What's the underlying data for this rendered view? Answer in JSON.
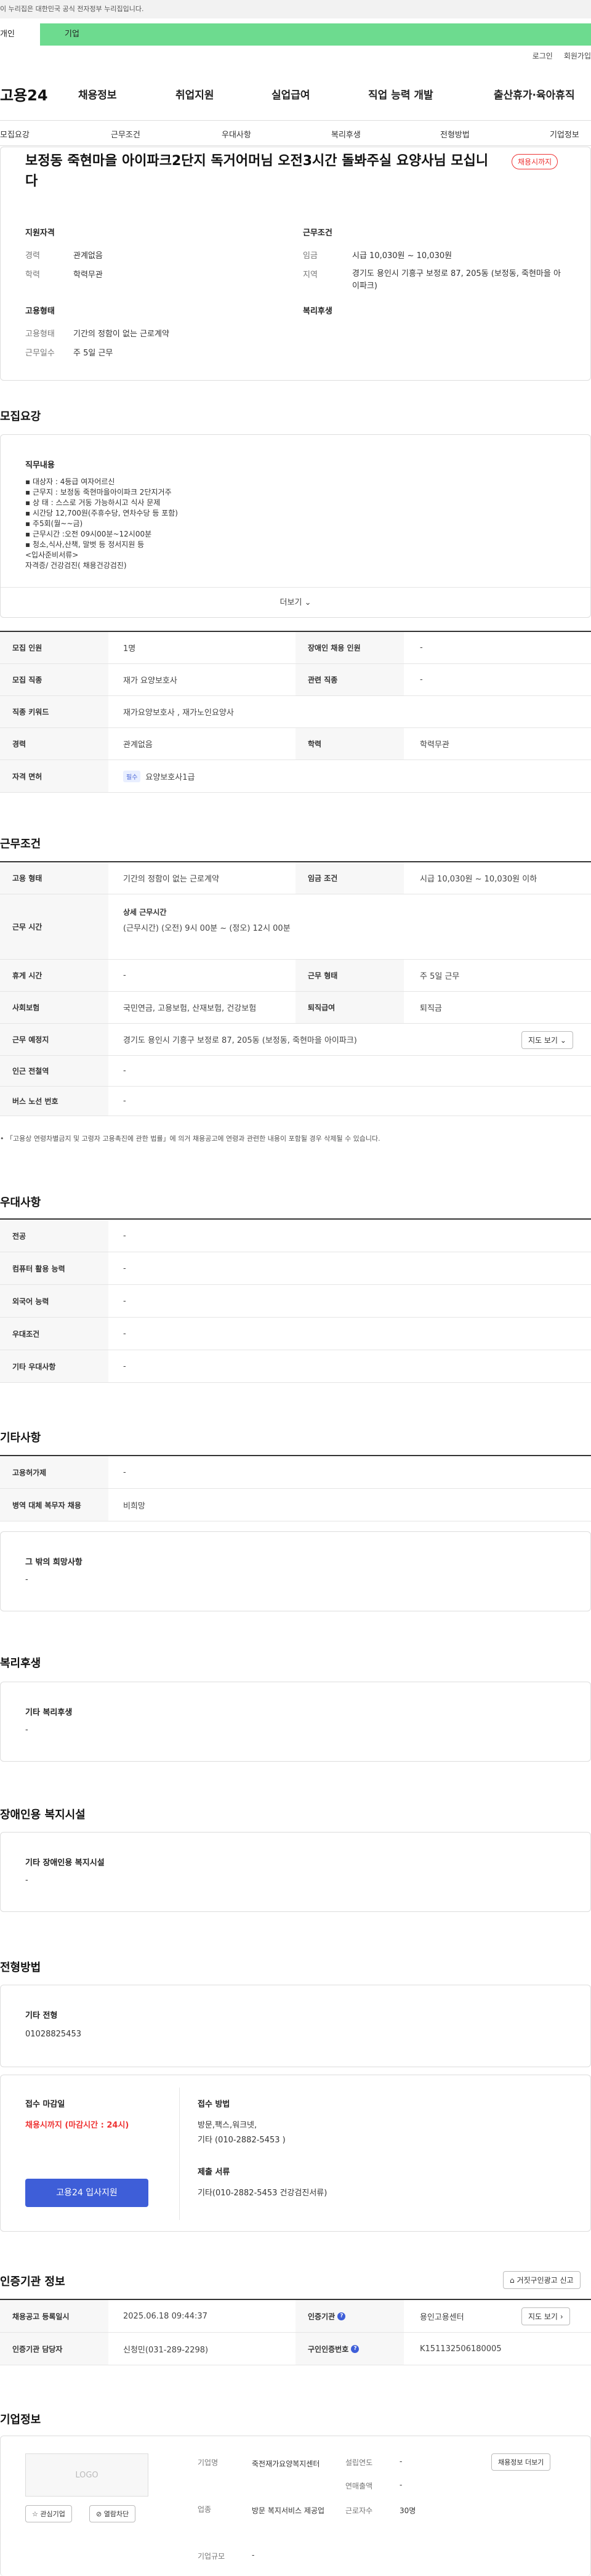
{
  "gov_banner": "이 누리집은 대한민국 공식 전자정부 누리집입니다.",
  "tabs": {
    "personal": "개인",
    "business": "기업"
  },
  "util": {
    "login": "로그인",
    "join": "회원가입"
  },
  "logo": "고용24",
  "gnb": [
    "채용정보",
    "취업지원",
    "실업급여",
    "직업 능력 개발",
    "출산휴가·육아휴직"
  ],
  "subnav": [
    "모집요강",
    "근무조건",
    "우대사항",
    "복리후생",
    "전형방법",
    "기업정보"
  ],
  "job": {
    "title": "보정동 죽현마을 아이파크2단지 독거어머님 오전3시간 돌봐주실 요양사님 모십니다",
    "badge": "채용시까지",
    "qual_title": "지원자격",
    "career_k": "경력",
    "career_v": "관계없음",
    "edu_k": "학력",
    "edu_v": "학력무관",
    "cond_title": "근무조건",
    "wage_k": "임금",
    "wage_v": "시급 10,030원 ~ 10,030원",
    "region_k": "지역",
    "region_v": "경기도 용인시 기흥구 보정로 87, 205동 (보정동, 죽현마을 아이파크)",
    "type_title": "고용형태",
    "emp_k": "고용형태",
    "emp_v": "기간의 정함이 없는 근로계약",
    "days_k": "근무일수",
    "days_v": "주 5일 근무",
    "welfare_title": "복리후생"
  },
  "recruit": {
    "section": "모집요강",
    "duty_title": "직무내용",
    "duty_lines": [
      "▪ 대상자 : 4등급 여자어르신",
      "▪ 근무지 : 보정동 죽현마을아이파크 2단지거주",
      "▪ 상 태 : 스스로 거동 가능하시고 식사 문제",
      "▪ 시간당 12,700원(주휴수당, 연차수당 등 포함)",
      "▪ 주5회(월~~금)",
      "▪ 근무시간 :오전 09시00분~12시00분",
      "▪ 청소,식사,산책, 말벗 등 정서지원 등",
      "<입사준비서류>",
      "자격증/ 건강검진( 채용건강검진)"
    ],
    "more": "더보기",
    "rows": [
      {
        "k1": "모집 인원",
        "v1": "1명",
        "k2": "장애인 채용 인원",
        "v2": "-"
      },
      {
        "k1": "모집 직종",
        "v1": "재가 요양보호사",
        "k2": "관련 직종",
        "v2": "-"
      },
      {
        "k1": "직종 키워드",
        "v1": "재가요양보호사 , 재가노인요양사"
      },
      {
        "k1": "경력",
        "v1": "관계없음",
        "k2": "학력",
        "v2": "학력무관"
      },
      {
        "k1": "자격 면허",
        "tag": "필수",
        "v1": "요양보호사1급"
      }
    ]
  },
  "work": {
    "section": "근무조건",
    "emp_k": "고용 형태",
    "emp_v": "기간의 정함이 없는 근로계약",
    "wage_k": "임금 조건",
    "wage_v": "시급 10,030원 ~ 10,030원 이하",
    "time_k": "근무 시간",
    "time_title": "상세 근무시간",
    "time_v": "(근무시간) (오전) 9시 00분 ~ (정오) 12시 00분",
    "rest_k": "휴게 시간",
    "rest_v": "-",
    "form_k": "근무 형태",
    "form_v": "주 5일 근무",
    "ins_k": "사회보험",
    "ins_v": "국민연금, 고용보험, 산재보험, 건강보험",
    "ret_k": "퇴직급여",
    "ret_v": "퇴직금",
    "place_k": "근무 예정지",
    "place_v": "경기도 용인시 기흥구 보정로 87, 205동 (보정동, 죽현마을 아이파크)",
    "map_btn": "지도 보기",
    "subway_k": "인근 전철역",
    "subway_v": "-",
    "bus_k": "버스 노선 번호",
    "bus_v": "-",
    "note": "• 「고용상 연령차별금지 및 고령자 고용촉진에 관한 법률」에 의거 채용공고에 연령과 관련한 내용이 포함될 경우 삭제될 수 있습니다."
  },
  "pref": {
    "section": "우대사항",
    "rows": [
      {
        "k": "전공",
        "v": "-"
      },
      {
        "k": "컴퓨터 활용 능력",
        "v": "-"
      },
      {
        "k": "외국어 능력",
        "v": "-"
      },
      {
        "k": "우대조건",
        "v": "-"
      },
      {
        "k": "기타 우대사항",
        "v": "-"
      }
    ]
  },
  "etc": {
    "section": "기타사항",
    "rows": [
      {
        "k": "고용허가제",
        "v": "-"
      },
      {
        "k": "병역 대체 복무자 채용",
        "v": "비희망"
      }
    ],
    "box_title": "그 밖의 희망사항",
    "box_v": "-"
  },
  "benefit": {
    "section": "복리후생",
    "box_title": "기타 복리후생",
    "box_v": "-"
  },
  "disabled": {
    "section": "장애인용 복지시설",
    "box_title": "기타 장애인용 복지시설",
    "box_v": "-"
  },
  "process": {
    "section": "전형방법",
    "box_title": "기타 전형",
    "box_v": "01028825453",
    "deadline_title": "접수 마감일",
    "deadline_v": "채용시까지 (마감시간 : 24시)",
    "apply_btn": "고용24 입사지원",
    "method_title": "접수 방법",
    "method_v1": "방문,팩스,워크넷,",
    "method_v2": "기타 (010-2882-5453 )",
    "docs_title": "제출 서류",
    "docs_v": "기타(010-2882-5453 건강검진서류)"
  },
  "cert": {
    "section": "인증기관 정보",
    "report_btn": "거짓구인광고 신고",
    "reg_k": "채용공고 등록일시",
    "reg_v": "2025.06.18 09:44:37",
    "org_k": "인증기관",
    "org_v": "용인고용센터",
    "map_btn": "지도 보기",
    "mgr_k": "인증기관 담당자",
    "mgr_v": "신청민(031-289-2298)",
    "num_k": "구인인증번호",
    "num_v": "K151132506180005"
  },
  "company": {
    "section": "기업정보",
    "logo": "LOGO",
    "fav_btn": "관심기업",
    "block_btn": "열람차단",
    "jobs_btn": "채용정보 더보기",
    "name_k": "기업명",
    "name_v": "죽전재가요양복지센터",
    "ind_k": "업종",
    "ind_v": "방문 복지서비스 제공업",
    "size_k": "기업규모",
    "size_v": "-",
    "year_k": "설립연도",
    "year_v": "-",
    "sales_k": "연매출액",
    "sales_v": "-",
    "emp_k": "근로자수",
    "emp_v": "30명"
  }
}
